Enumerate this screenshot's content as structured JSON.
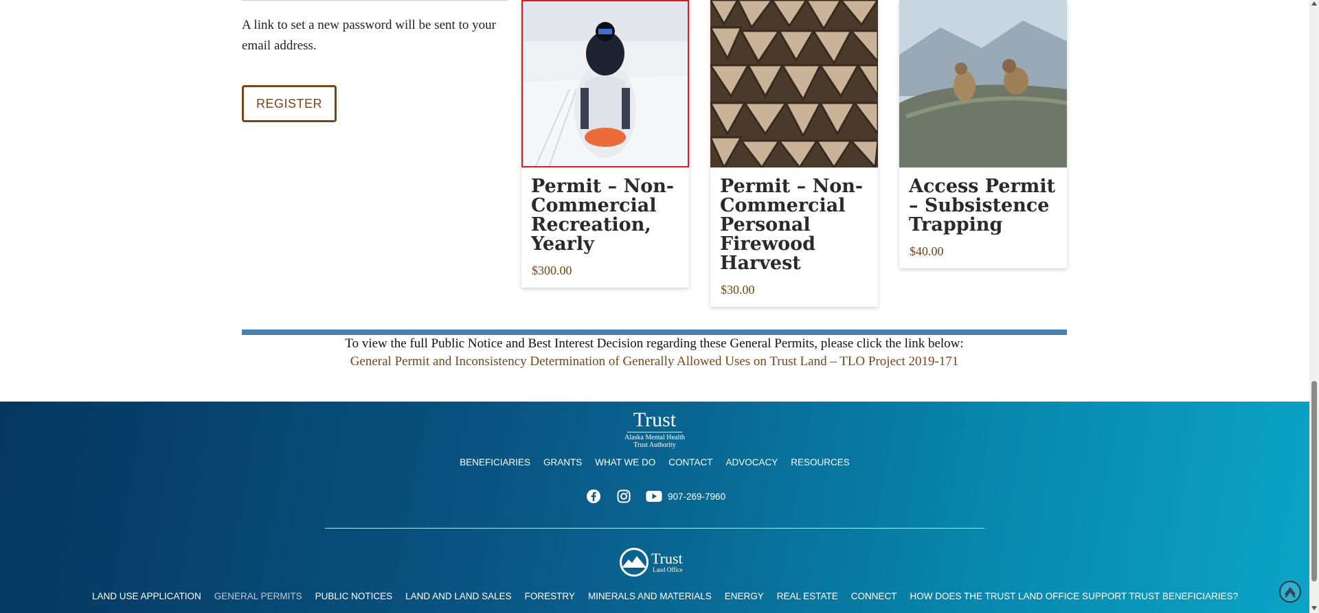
{
  "account": {
    "reset_text": "A link to set a new password will be sent to your email address.",
    "register_label": "REGISTER"
  },
  "products": [
    {
      "title": "Permit – Non-Commercial Recreation, Yearly",
      "price": "$300.00",
      "image_icon": "snowmobile-photo"
    },
    {
      "title": "Permit – Non-Commercial Personal Firewood Harvest",
      "price": "$30.00",
      "image_icon": "firewood-stack-photo"
    },
    {
      "title": "Access Permit – Subsistence Trapping",
      "price": "$40.00",
      "image_icon": "marmots-photo"
    }
  ],
  "notice": {
    "text": "To view the full Public Notice and Best Interest Decision regarding these General Permits, please click the link below:",
    "link": "General Permit and Inconsistency Determination of Generally Allowed Uses on Trust Land – TLO Project 2019-171"
  },
  "footer": {
    "trust_logo": {
      "word": "Trust",
      "line1": "Alaska Mental Health",
      "line2": "Trust Authority"
    },
    "nav1": [
      "BENEFICIARIES",
      "GRANTS",
      "WHAT WE DO",
      "CONTACT",
      "ADVOCACY",
      "RESOURCES"
    ],
    "social": {
      "facebook": "facebook-icon",
      "instagram": "instagram-icon",
      "youtube": "youtube-icon",
      "phone": "907-269-7960"
    },
    "tlo_logo": {
      "word": "Trust",
      "sub": "Land Office"
    },
    "nav2": [
      "LAND USE APPLICATION",
      "GENERAL PERMITS",
      "PUBLIC NOTICES",
      "LAND AND LAND SALES",
      "FORESTRY",
      "MINERALS AND MATERIALS",
      "ENERGY",
      "REAL ESTATE",
      "CONNECT",
      "HOW DOES THE TRUST LAND OFFICE SUPPORT TRUST BENEFICIARIES?"
    ],
    "nav2_current": "GENERAL PERMITS"
  },
  "colors": {
    "brand_brown": "#7a4516",
    "notice_rule": "#4a7fad",
    "footer_dark": "#05365f",
    "footer_light": "#0ba4c6",
    "active_outline": "#e0191e"
  }
}
